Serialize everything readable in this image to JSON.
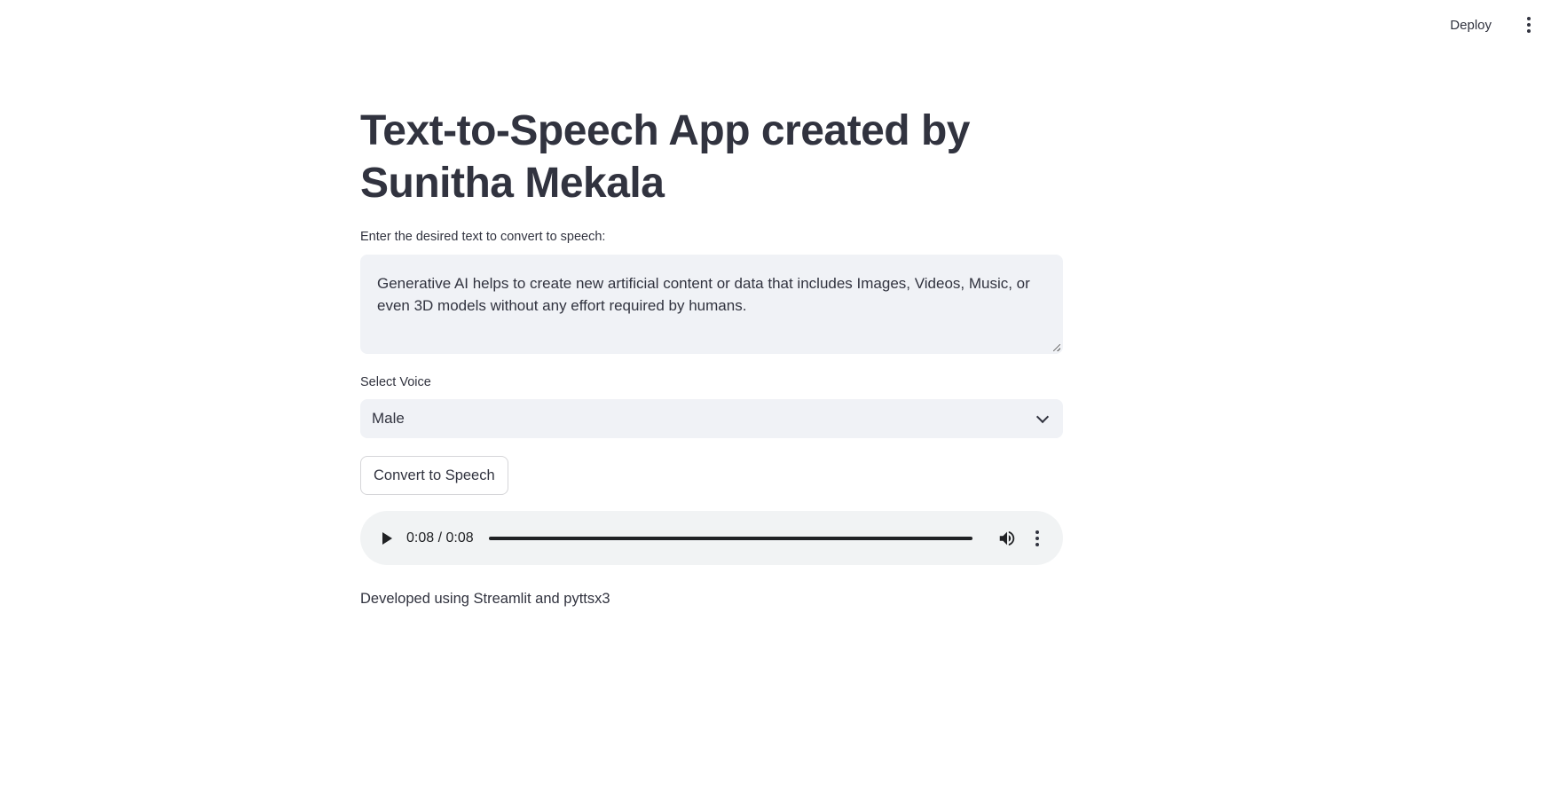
{
  "header": {
    "deploy_label": "Deploy",
    "menu_icon": "vertical-dots-icon"
  },
  "main": {
    "title": "Text-to-Speech App created by Sunitha Mekala",
    "text_input": {
      "label": "Enter the desired text to convert to speech:",
      "value": "Generative AI helps to create new artificial content or data that includes Images, Videos, Music, or even 3D models without any effort required by humans."
    },
    "voice_select": {
      "label": "Select Voice",
      "selected": "Male",
      "icon": "chevron-down-icon"
    },
    "convert_button_label": "Convert to Speech",
    "audio_player": {
      "time": "0:08 / 0:08",
      "progress": 1.0,
      "play_icon": "play-icon",
      "volume_icon": "volume-icon",
      "menu_icon": "vertical-dots-icon"
    },
    "footer": "Developed using Streamlit and pyttsx3"
  },
  "colors": {
    "text": "#31333f",
    "input_background": "#f0f2f6",
    "audio_background": "#f1f3f4"
  }
}
